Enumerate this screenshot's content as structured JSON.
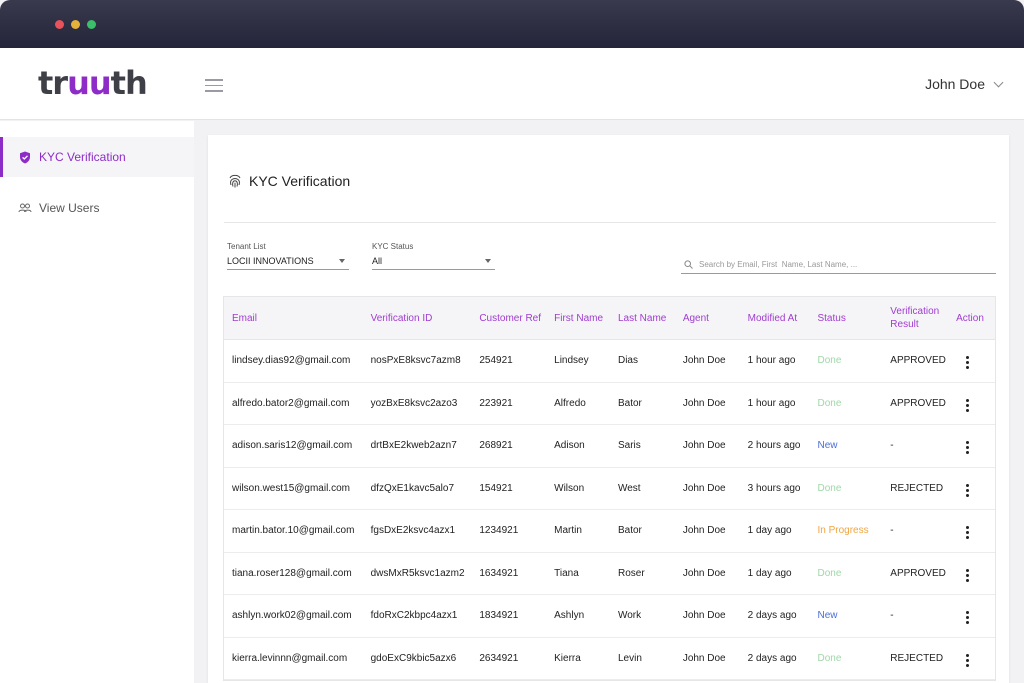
{
  "window": {
    "controls": [
      "close",
      "minimize",
      "maximize"
    ]
  },
  "header": {
    "logo_parts": [
      "tr",
      "uu",
      "th"
    ],
    "menu_icon": "hamburger-icon",
    "user_name": "John Doe"
  },
  "sidebar": {
    "items": [
      {
        "label": "KYC Verification",
        "icon": "shield-check-icon",
        "active": true
      },
      {
        "label": "View Users",
        "icon": "users-icon",
        "active": false
      }
    ]
  },
  "main": {
    "title": "KYC Verification",
    "title_icon": "fingerprint-icon",
    "filters": {
      "tenant": {
        "label": "Tenant List",
        "value": "LOCII INNOVATIONS"
      },
      "kyc_status": {
        "label": "KYC Status",
        "value": "All"
      }
    },
    "search": {
      "placeholder": "Search by Email, First  Name, Last Name, ..."
    },
    "table": {
      "columns": [
        "Email",
        "Verification ID",
        "Customer Ref",
        "First Name",
        "Last Name",
        "Agent",
        "Modified At",
        "Status",
        "Verification Result",
        "Action"
      ],
      "rows": [
        [
          "lindsey.dias92@gmail.com",
          "nosPxE8ksvc7azm8",
          "254921",
          "Lindsey",
          "Dias",
          "John Doe",
          "1 hour ago",
          "Done",
          "APPROVED"
        ],
        [
          "alfredo.bator2@gmail.com",
          "yozBxE8ksvc2azo3",
          "223921",
          "Alfredo",
          "Bator",
          "John Doe",
          "1 hour ago",
          "Done",
          "APPROVED"
        ],
        [
          "adison.saris12@gmail.com",
          "drtBxE2kweb2azn7",
          "268921",
          "Adison",
          "Saris",
          "John Doe",
          "2 hours ago",
          "New",
          "-"
        ],
        [
          "wilson.west15@gmail.com",
          "dfzQxE1kavc5alo7",
          "154921",
          "Wilson",
          "West",
          "John Doe",
          "3 hours ago",
          "Done",
          "REJECTED"
        ],
        [
          "martin.bator.10@gmail.com",
          "fgsDxE2ksvc4azx1",
          "1234921",
          "Martin",
          "Bator",
          "John Doe",
          "1 day ago",
          "In Progress",
          "-"
        ],
        [
          "tiana.roser128@gmail.com",
          "dwsMxR5ksvc1azm2",
          "1634921",
          "Tiana",
          "Roser",
          "John Doe",
          "1 day ago",
          "Done",
          "APPROVED"
        ],
        [
          "ashlyn.work02@gmail.com",
          "fdoRxC2kbpc4azx1",
          "1834921",
          "Ashlyn",
          "Work",
          "John Doe",
          "2 days ago",
          "New",
          "-"
        ],
        [
          "kierra.levinnn@gmail.com",
          "gdoExC9kbic5azx6",
          "2634921",
          "Kierra",
          "Levin",
          "John Doe",
          "2 days ago",
          "Done",
          "REJECTED"
        ]
      ]
    }
  },
  "colors": {
    "accent": "#8e2cc8",
    "done": "#9fd7a8",
    "new": "#4a6fd8",
    "in_progress": "#f0a542"
  }
}
